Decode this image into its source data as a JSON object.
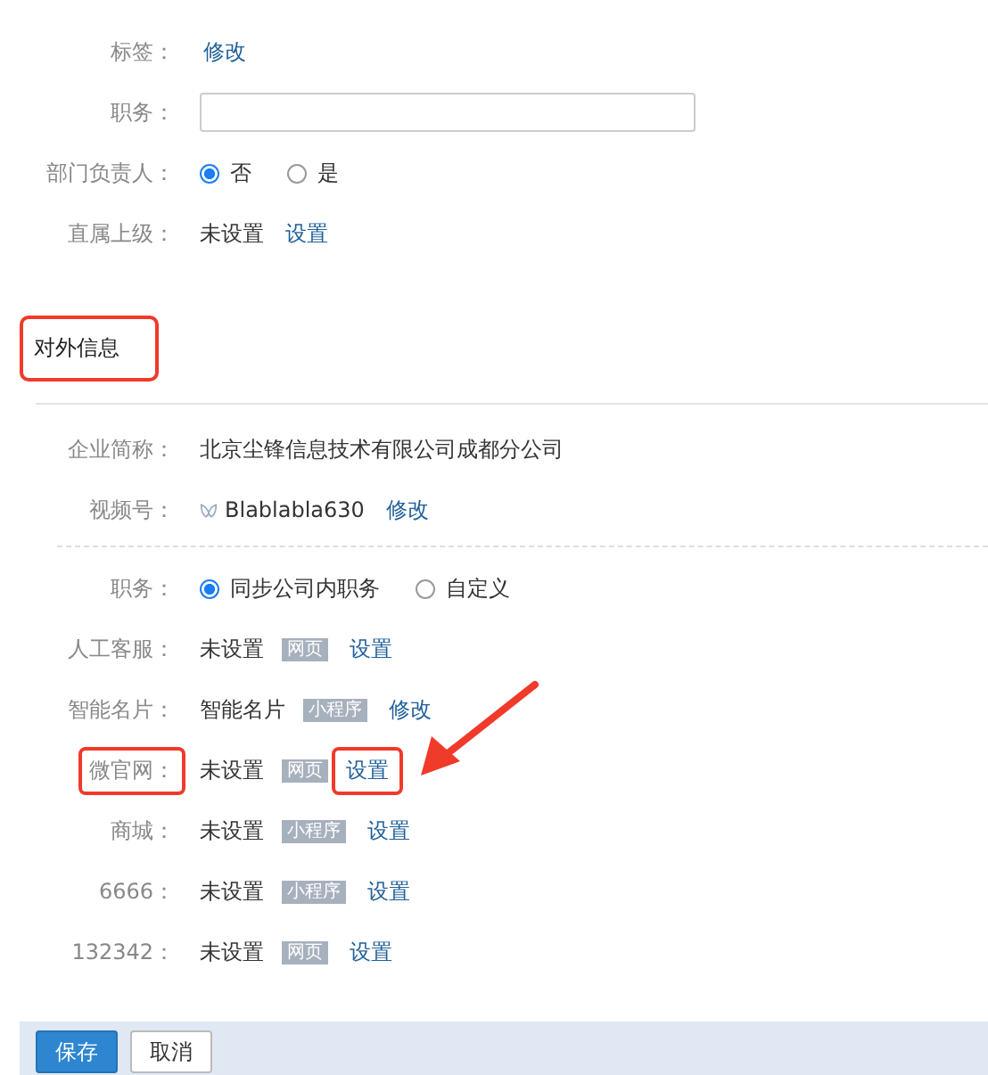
{
  "basic_rows": [
    {
      "kind": "link",
      "label": "标签：",
      "link": "修改"
    },
    {
      "kind": "input",
      "label": "职务："
    },
    {
      "kind": "radio",
      "label": "部门负责人：",
      "options": [
        {
          "label": "否",
          "selected": true
        },
        {
          "label": "是",
          "selected": false
        }
      ]
    },
    {
      "kind": "value_link",
      "label": "直属上级：",
      "value": "未设置",
      "link": "设置"
    }
  ],
  "external_section": {
    "title": "对外信息",
    "annotated": true
  },
  "external_rows": [
    {
      "kind": "text",
      "label": "企业简称：",
      "value": "北京尘锋信息技术有限公司成都分公司"
    },
    {
      "kind": "video",
      "label": "视频号：",
      "value": "Blablabla630",
      "link": "修改"
    }
  ],
  "profile_rows": [
    {
      "kind": "radio",
      "label": "职务：",
      "options": [
        {
          "label": "同步公司内职务",
          "selected": true
        },
        {
          "label": "自定义",
          "selected": false
        }
      ]
    },
    {
      "kind": "service",
      "label": "人工客服：",
      "value": "未设置",
      "badge": "网页",
      "link": "设置",
      "annotated": false
    },
    {
      "kind": "service",
      "label": "智能名片：",
      "value": "智能名片",
      "badge": "小程序",
      "link": "修改",
      "annotated": false
    },
    {
      "kind": "service",
      "label": "微官网：",
      "value": "未设置",
      "badge": "网页",
      "link": "设置",
      "annotated": true
    },
    {
      "kind": "service",
      "label": "商城：",
      "value": "未设置",
      "badge": "小程序",
      "link": "设置",
      "annotated": false
    },
    {
      "kind": "service",
      "label": "6666：",
      "value": "未设置",
      "badge": "小程序",
      "link": "设置",
      "annotated": false
    },
    {
      "kind": "service",
      "label": "132342：",
      "value": "未设置",
      "badge": "网页",
      "link": "设置",
      "annotated": false
    }
  ],
  "buttons": [
    {
      "label": "保存",
      "kind": "primary"
    },
    {
      "label": "取消",
      "kind": "default"
    }
  ]
}
